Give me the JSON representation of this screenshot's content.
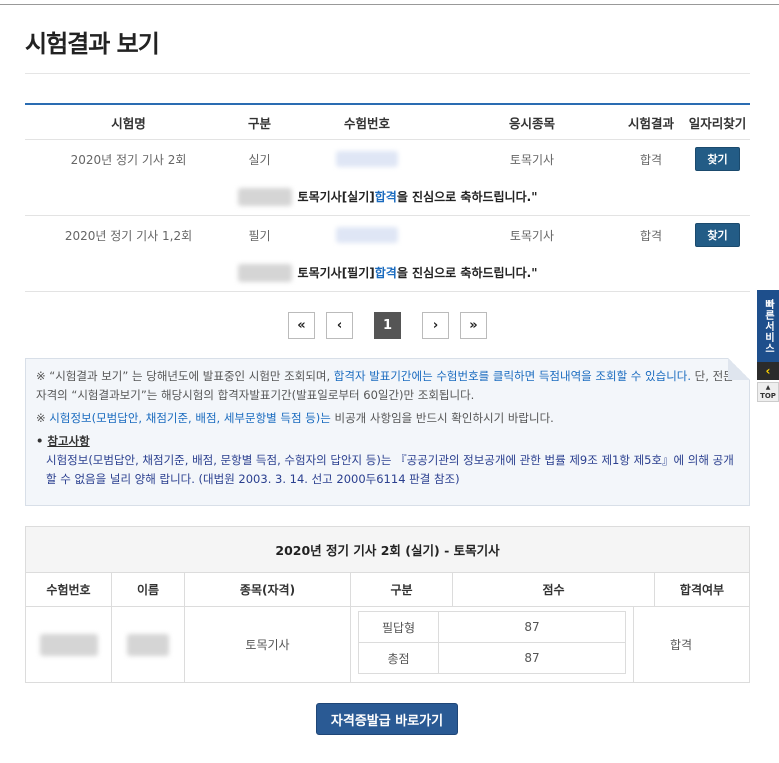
{
  "page": {
    "title": "시험결과 보기"
  },
  "results_table": {
    "headers": [
      "시험명",
      "구분",
      "수험번호",
      "응시종목",
      "시험결과",
      "일자리찾기"
    ],
    "rows": [
      {
        "exam_name": "2020년 정기 기사 2회",
        "type": "실기",
        "field": "토목기사",
        "result": "합격",
        "find_label": "찾기",
        "msg_prefix": "토목기사[실기] ",
        "msg_pass": "합격",
        "msg_suffix": "을 진심으로 축하드립니다.\""
      },
      {
        "exam_name": "2020년 정기 기사 1,2회",
        "type": "필기",
        "field": "토목기사",
        "result": "합격",
        "find_label": "찾기",
        "msg_prefix": "토목기사[필기] ",
        "msg_pass": "합격",
        "msg_suffix": "을 진심으로 축하드립니다.\""
      }
    ]
  },
  "pagination": {
    "first": "«",
    "prev": "‹",
    "current": "1",
    "next": "›",
    "last": "»"
  },
  "notice": {
    "line1_a": "※ “시험결과 보기” 는 당해년도에 발표중인 시험만 조회되며, ",
    "line1_b": "합격자 발표기간에는 수험번호를 클릭하면 득점내역을 조회할 수 있습니다.",
    "line1_c": " 단, 전문자격의 “시험결과보기”는 해당시험의 합격자발표기간(발표일로부터 60일간)만 조회됩니다.",
    "line2_a": "※ ",
    "line2_b": "시험정보(모범답안, 채점기준, 배점, 세부문항별 득점 등)는",
    "line2_c": " 비공개 사항임을 반드시 확인하시기 바랍니다.",
    "ref_bullet": "• ",
    "ref_title": "참고사항",
    "ref_body": "시험정보(모범답안, 채점기준, 배점, 문항별 득점, 수험자의 답안지 등)는 『공공기관의 정보공개에 관한 법률 제9조 제1항 제5호』에 의해 공개할 수 없음을 널리 양해 랍니다. (대법원 2003. 3. 14. 선고 2000두6114 판결 참조)"
  },
  "side": {
    "quick": "빠른서비스",
    "arrow": "‹",
    "top": "TOP"
  },
  "detail": {
    "title": "2020년 정기 기사 2회 (실기) - 토목기사",
    "headers": [
      "수험번호",
      "이름",
      "종목(자격)",
      "구분",
      "점수",
      "합격여부"
    ],
    "field": "토목기사",
    "scores": [
      {
        "label": "필답형",
        "score": "87"
      },
      {
        "label": "총점",
        "score": "87"
      }
    ],
    "pass": "합격"
  },
  "cert_button": "자격증발급 바로가기"
}
